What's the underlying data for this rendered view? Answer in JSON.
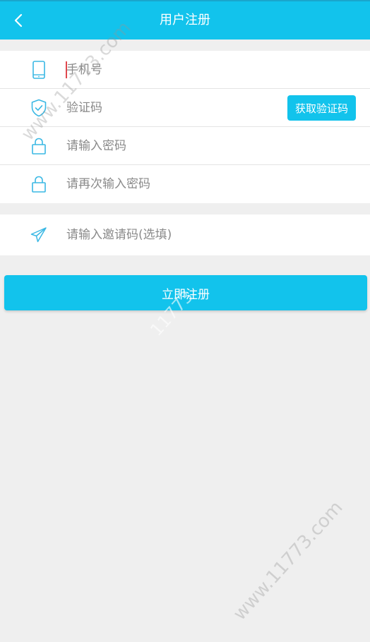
{
  "header": {
    "title": "用户注册"
  },
  "form": {
    "phone_placeholder": "手机号",
    "code_placeholder": "验证码",
    "get_code_label": "获取验证码",
    "password_placeholder": "请输入密码",
    "confirm_password_placeholder": "请再次输入密码",
    "invite_placeholder": "请输入邀请码(选填)"
  },
  "actions": {
    "submit_label": "立即注册"
  },
  "icons": {
    "back": "chevron-left-icon",
    "phone": "phone-icon",
    "code": "shield-check-icon",
    "password": "lock-icon",
    "confirm_password": "lock-icon",
    "invite": "paper-plane-icon"
  },
  "colors": {
    "accent": "#12c3ec",
    "icon": "#3ab8e4",
    "background": "#efefef"
  },
  "watermark": {
    "text1": "www.11773.com",
    "text2": "11773",
    "text3": "www.11773.com"
  }
}
